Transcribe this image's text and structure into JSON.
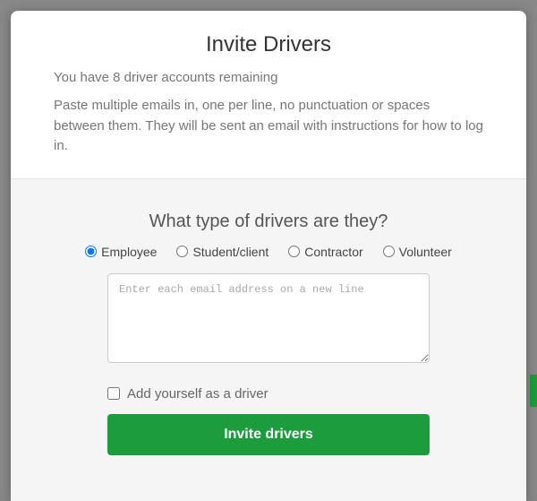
{
  "header": {
    "title": "Invite Drivers",
    "subtitle": "You have 8 driver accounts remaining",
    "instructions": "Paste multiple emails in, one per line, no punctuation or spaces between them. They will be sent an email with instructions for how to log in."
  },
  "body": {
    "question": "What type of drivers are they?",
    "driver_types": [
      {
        "label": "Employee",
        "selected": true
      },
      {
        "label": "Student/client",
        "selected": false
      },
      {
        "label": "Contractor",
        "selected": false
      },
      {
        "label": "Volunteer",
        "selected": false
      }
    ],
    "email_placeholder": "Enter each email address on a new line",
    "email_value": "",
    "add_self_label": "Add yourself as a driver",
    "add_self_checked": false,
    "invite_button_label": "Invite drivers"
  }
}
